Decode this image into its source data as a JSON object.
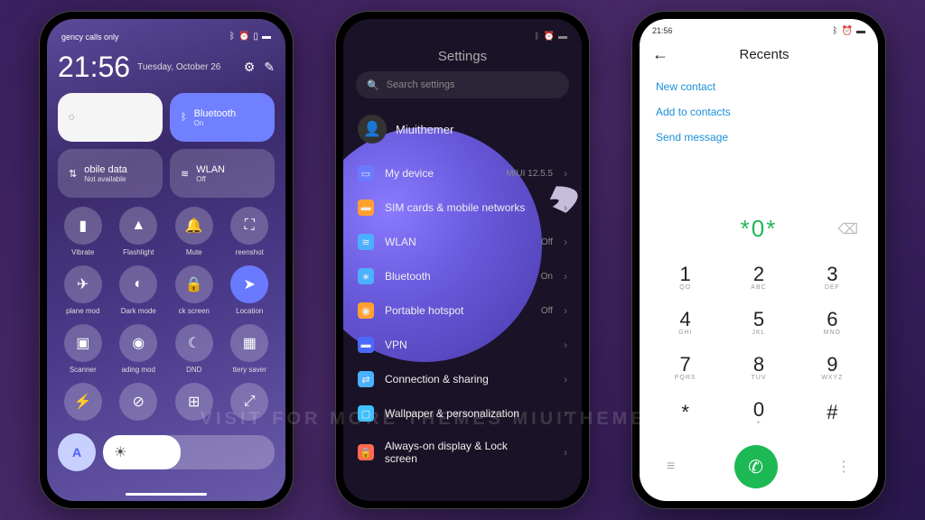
{
  "watermark": "VISIT FOR MORE THEMES   MIUITHEMER.COM",
  "cc": {
    "carrier": "gency calls only",
    "time": "21:56",
    "date": "Tuesday, October 26",
    "tiles": {
      "t1_icon": "◌",
      "t2_label": "Bluetooth",
      "t2_sub": "On",
      "t3_label": "obile data",
      "t3_sub": "Not available",
      "t4_label": "WLAN",
      "t4_sub": "Off"
    },
    "qs": [
      {
        "icon": "▮",
        "label": "Vibrate"
      },
      {
        "icon": "▲",
        "label": "Flashlight"
      },
      {
        "icon": "🔔",
        "label": "Mute"
      },
      {
        "icon": "⛶",
        "label": "reenshot"
      },
      {
        "icon": "✈",
        "label": "plane mod"
      },
      {
        "icon": "◐",
        "label": "Dark mode"
      },
      {
        "icon": "🔒",
        "label": "ck screen"
      },
      {
        "icon": "➤",
        "label": "Location",
        "on": true
      },
      {
        "icon": "▣",
        "label": "Scanner"
      },
      {
        "icon": "◉",
        "label": "ading mod"
      },
      {
        "icon": "☾",
        "label": "DND"
      },
      {
        "icon": "▦",
        "label": "ttery saver"
      },
      {
        "icon": "⚡",
        "label": ""
      },
      {
        "icon": "⊘",
        "label": ""
      },
      {
        "icon": "⊞",
        "label": ""
      },
      {
        "icon": "⤢",
        "label": ""
      }
    ],
    "auto": "A"
  },
  "settings": {
    "title": "Settings",
    "search": "Search settings",
    "account": {
      "name": "Miuithemer",
      "sub": ""
    },
    "items": [
      {
        "icon": "▭",
        "color": "#6a7aff",
        "label": "My device",
        "value": "MIUI 12.5.5"
      },
      {
        "icon": "▬",
        "color": "#ffa030",
        "label": "SIM cards & mobile networks",
        "value": ""
      },
      {
        "icon": "≋",
        "color": "#4ab0ff",
        "label": "WLAN",
        "value": "Off"
      },
      {
        "icon": "∗",
        "color": "#4ab0ff",
        "label": "Bluetooth",
        "value": "On"
      },
      {
        "icon": "◉",
        "color": "#ffa030",
        "label": "Portable hotspot",
        "value": "Off"
      },
      {
        "icon": "▬",
        "color": "#4a6aff",
        "label": "VPN",
        "value": ""
      },
      {
        "icon": "⇄",
        "color": "#4ab0ff",
        "label": "Connection & sharing",
        "value": ""
      },
      {
        "icon": "▢",
        "color": "#40c0ff",
        "label": "Wallpaper & personalization",
        "value": ""
      },
      {
        "icon": "🔒",
        "color": "#ff6a50",
        "label": "Always-on display & Lock screen",
        "value": ""
      }
    ]
  },
  "dialer": {
    "time": "21:56",
    "title": "Recents",
    "links": [
      "New contact",
      "Add to contacts",
      "Send message"
    ],
    "display": "*0*",
    "keys": [
      {
        "n": "1",
        "s": "QO"
      },
      {
        "n": "2",
        "s": "ABC"
      },
      {
        "n": "3",
        "s": "DEF"
      },
      {
        "n": "4",
        "s": "GHI"
      },
      {
        "n": "5",
        "s": "JKL"
      },
      {
        "n": "6",
        "s": "MNO"
      },
      {
        "n": "7",
        "s": "PQRS"
      },
      {
        "n": "8",
        "s": "TUV"
      },
      {
        "n": "9",
        "s": "WXYZ"
      },
      {
        "n": "*",
        "s": ""
      },
      {
        "n": "0",
        "s": "+"
      },
      {
        "n": "#",
        "s": ""
      }
    ]
  }
}
